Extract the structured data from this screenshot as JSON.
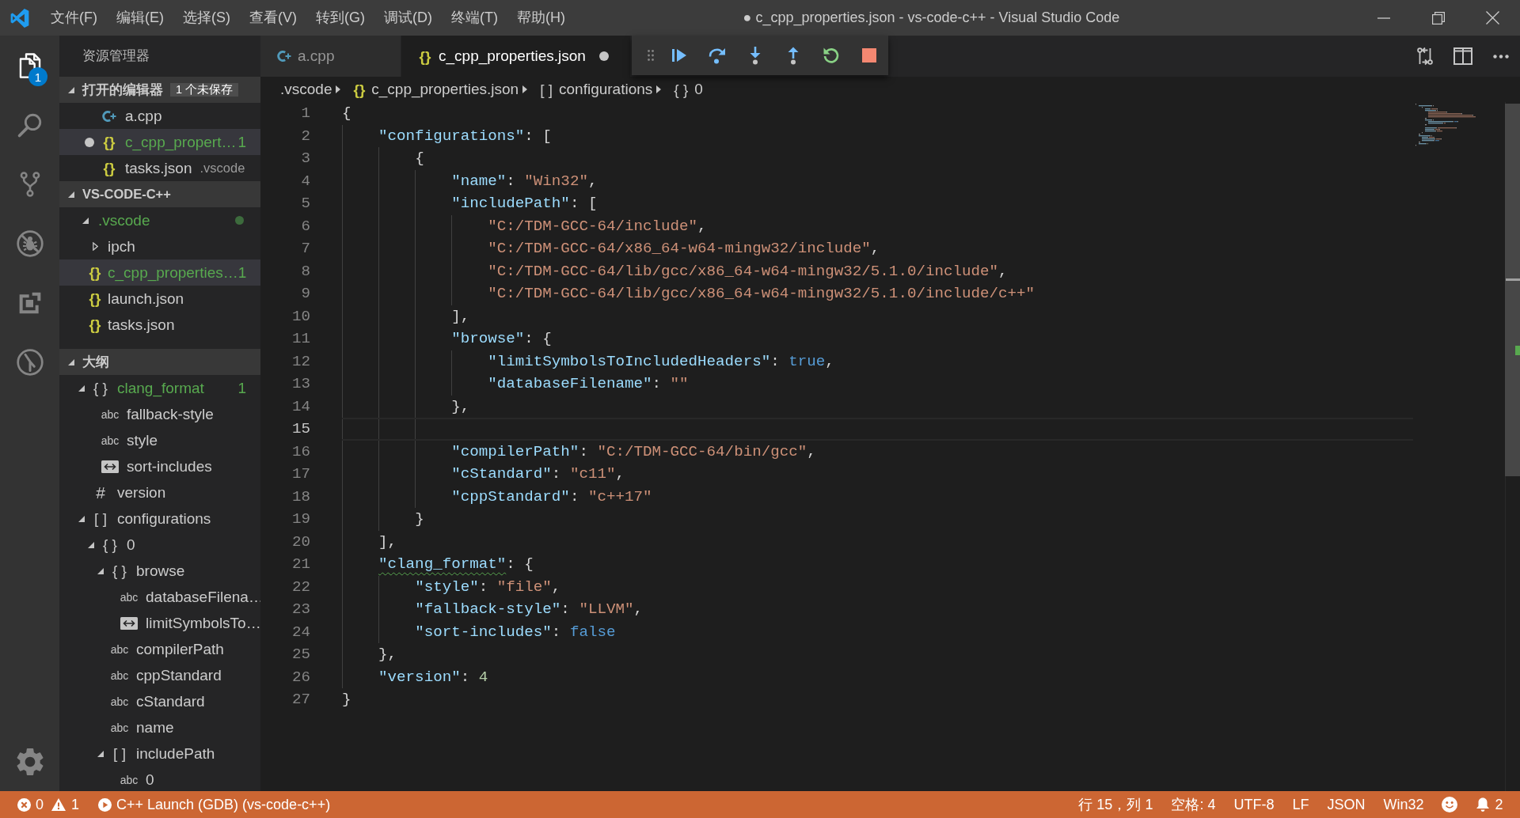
{
  "window": {
    "title": "● c_cpp_properties.json - vs-code-c++ - Visual Studio Code",
    "menu": [
      "文件(F)",
      "编辑(E)",
      "选择(S)",
      "查看(V)",
      "转到(G)",
      "调试(D)",
      "终端(T)",
      "帮助(H)"
    ]
  },
  "activity_bar": {
    "items": [
      {
        "kind": "explorer",
        "selected": true,
        "badge": "1"
      },
      {
        "kind": "search",
        "selected": false
      },
      {
        "kind": "scm",
        "selected": false
      },
      {
        "kind": "debug",
        "selected": false
      },
      {
        "kind": "extensions",
        "selected": false
      },
      {
        "kind": "timeline",
        "selected": false
      }
    ]
  },
  "sidebar": {
    "title": "资源管理器",
    "open_editors": {
      "title": "打开的编辑器",
      "expanded": true,
      "badge": "1 个未保存",
      "items": [
        {
          "kind": "cpp",
          "label": "a.cpp",
          "dirty": false,
          "selected": false,
          "warning": false
        },
        {
          "kind": "json",
          "icon": "{}",
          "label": "c_cpp_propert…",
          "dirty": true,
          "selected": true,
          "warning": true,
          "problems": "1"
        },
        {
          "kind": "json",
          "icon": "{}",
          "label": "tasks.json",
          "description": ".vscode",
          "dirty": false,
          "selected": false,
          "warning": false
        }
      ]
    },
    "folder": {
      "title": "VS-CODE-C++",
      "expanded": true,
      "items": [
        {
          "kind": "folder",
          "label": ".vscode",
          "expanded": true,
          "selected": false,
          "warning": true,
          "children": [
            {
              "kind": "folder",
              "label": "ipch",
              "expanded": false,
              "selected": false,
              "warning": false
            },
            {
              "kind": "json",
              "icon": "{}",
              "label": "c_cpp_properties…",
              "selected": true,
              "warning": true,
              "problems": "1"
            },
            {
              "kind": "json",
              "icon": "{}",
              "label": "launch.json",
              "selected": false,
              "warning": false
            },
            {
              "kind": "json",
              "icon": "{}",
              "label": "tasks.json",
              "selected": false,
              "warning": false
            }
          ]
        }
      ]
    },
    "outline": {
      "title": "大纲",
      "expanded": true,
      "items": [
        {
          "kind": "object",
          "icon": "{ }",
          "label": "clang_format",
          "expanded": true,
          "selected": false,
          "warning": true,
          "problems": "1",
          "children": [
            {
              "kind": "string",
              "icon": "abc",
              "label": "fallback-style",
              "selected": false,
              "warning": false
            },
            {
              "kind": "string",
              "icon": "abc",
              "label": "style",
              "selected": false,
              "warning": false
            },
            {
              "kind": "boolean",
              "label": "sort-includes",
              "selected": false,
              "warning": false
            }
          ]
        },
        {
          "kind": "number",
          "icon": "#",
          "label": "version",
          "selected": false,
          "warning": false
        },
        {
          "kind": "array",
          "icon": "[ ]",
          "label": "configurations",
          "expanded": true,
          "selected": false,
          "warning": false,
          "children": [
            {
              "kind": "object",
              "icon": "{ }",
              "label": "0",
              "expanded": true,
              "selected": false,
              "warning": false,
              "children": [
                {
                  "kind": "object",
                  "icon": "{ }",
                  "label": "browse",
                  "expanded": true,
                  "selected": false,
                  "warning": false,
                  "children": [
                    {
                      "kind": "string",
                      "icon": "abc",
                      "label": "databaseFilena…",
                      "selected": false,
                      "warning": false
                    },
                    {
                      "kind": "boolean",
                      "label": "limitSymbolsTo…",
                      "selected": false,
                      "warning": false
                    }
                  ]
                },
                {
                  "kind": "string",
                  "icon": "abc",
                  "label": "compilerPath",
                  "selected": false,
                  "warning": false
                },
                {
                  "kind": "string",
                  "icon": "abc",
                  "label": "cppStandard",
                  "selected": false,
                  "warning": false
                },
                {
                  "kind": "string",
                  "icon": "abc",
                  "label": "cStandard",
                  "selected": false,
                  "warning": false
                },
                {
                  "kind": "string",
                  "icon": "abc",
                  "label": "name",
                  "selected": false,
                  "warning": false
                },
                {
                  "kind": "array",
                  "icon": "[ ]",
                  "label": "includePath",
                  "expanded": true,
                  "selected": false,
                  "warning": false,
                  "children": [
                    {
                      "kind": "string",
                      "icon": "abc",
                      "label": "0",
                      "selected": false,
                      "warning": false
                    }
                  ]
                }
              ]
            }
          ]
        }
      ]
    }
  },
  "editor": {
    "tabs": [
      {
        "kind": "cpp",
        "label": "a.cpp",
        "selected": false,
        "dirty": false
      },
      {
        "kind": "json",
        "icon": "{}",
        "label": "c_cpp_properties.json",
        "selected": true,
        "dirty": true
      }
    ],
    "breadcrumbs": [
      {
        "kind": "folder",
        "label": ".vscode"
      },
      {
        "kind": "file",
        "icon": "{}",
        "label": "c_cpp_properties.json"
      },
      {
        "kind": "array",
        "icon": "[ ]",
        "label": "configurations"
      },
      {
        "kind": "object",
        "icon": "{ }",
        "label": "0"
      }
    ],
    "lines": [
      {
        "number": "1",
        "text": "{",
        "current": false,
        "warning": false
      },
      {
        "number": "2",
        "text": "    \"configurations\": [",
        "current": false,
        "warning": false
      },
      {
        "number": "3",
        "text": "        {",
        "current": false,
        "warning": false
      },
      {
        "number": "4",
        "text": "            \"name\": \"Win32\",",
        "current": false,
        "warning": false
      },
      {
        "number": "5",
        "text": "            \"includePath\": [",
        "current": false,
        "warning": false
      },
      {
        "number": "6",
        "text": "                \"C:/TDM-GCC-64/include\",",
        "current": false,
        "warning": false
      },
      {
        "number": "7",
        "text": "                \"C:/TDM-GCC-64/x86_64-w64-mingw32/include\",",
        "current": false,
        "warning": false
      },
      {
        "number": "8",
        "text": "                \"C:/TDM-GCC-64/lib/gcc/x86_64-w64-mingw32/5.1.0/include\",",
        "current": false,
        "warning": false
      },
      {
        "number": "9",
        "text": "                \"C:/TDM-GCC-64/lib/gcc/x86_64-w64-mingw32/5.1.0/include/c++\"",
        "current": false,
        "warning": false
      },
      {
        "number": "10",
        "text": "            ],",
        "current": false,
        "warning": false
      },
      {
        "number": "11",
        "text": "            \"browse\": {",
        "current": false,
        "warning": false
      },
      {
        "number": "12",
        "text": "                \"limitSymbolsToIncludedHeaders\": true,",
        "current": false,
        "warning": false
      },
      {
        "number": "13",
        "text": "                \"databaseFilename\": \"\"",
        "current": false,
        "warning": false
      },
      {
        "number": "14",
        "text": "            },",
        "current": false,
        "warning": false
      },
      {
        "number": "15",
        "current": true,
        "warning": false
      },
      {
        "number": "16",
        "text": "            \"compilerPath\": \"C:/TDM-GCC-64/bin/gcc\",",
        "current": false,
        "warning": false
      },
      {
        "number": "17",
        "text": "            \"cStandard\": \"c11\",",
        "current": false,
        "warning": false
      },
      {
        "number": "18",
        "text": "            \"cppStandard\": \"c++17\"",
        "current": false,
        "warning": false
      },
      {
        "number": "19",
        "text": "        }",
        "current": false,
        "warning": false
      },
      {
        "number": "20",
        "text": "    ],",
        "current": false,
        "warning": false
      },
      {
        "number": "21",
        "text": "    \"clang_format\": {",
        "current": false,
        "warning": true
      },
      {
        "number": "22",
        "text": "        \"style\": \"file\",",
        "current": false,
        "warning": false
      },
      {
        "number": "23",
        "text": "        \"fallback-style\": \"LLVM\",",
        "current": false,
        "warning": false
      },
      {
        "number": "24",
        "text": "        \"sort-includes\": false",
        "current": false,
        "warning": false
      },
      {
        "number": "25",
        "text": "    },",
        "current": false,
        "warning": false
      },
      {
        "number": "26",
        "text": "    \"version\": 4",
        "current": false,
        "warning": false
      },
      {
        "number": "27",
        "text": "}",
        "current": false,
        "warning": false
      }
    ]
  },
  "status_bar": {
    "left": [
      {
        "kind": "errors",
        "text": "0"
      },
      {
        "kind": "warnings",
        "text": "1"
      },
      {
        "kind": "debug",
        "text": "C++ Launch (GDB) (vs-code-c++)"
      }
    ],
    "right": [
      {
        "kind": "text",
        "text": "行 15，列 1"
      },
      {
        "kind": "text",
        "text": "空格: 4"
      },
      {
        "kind": "text",
        "text": "UTF-8"
      },
      {
        "kind": "text",
        "text": "LF"
      },
      {
        "kind": "text",
        "text": "JSON"
      },
      {
        "kind": "text",
        "text": "Win32"
      },
      {
        "kind": "feedback"
      },
      {
        "kind": "notifications",
        "text": "2"
      }
    ]
  }
}
